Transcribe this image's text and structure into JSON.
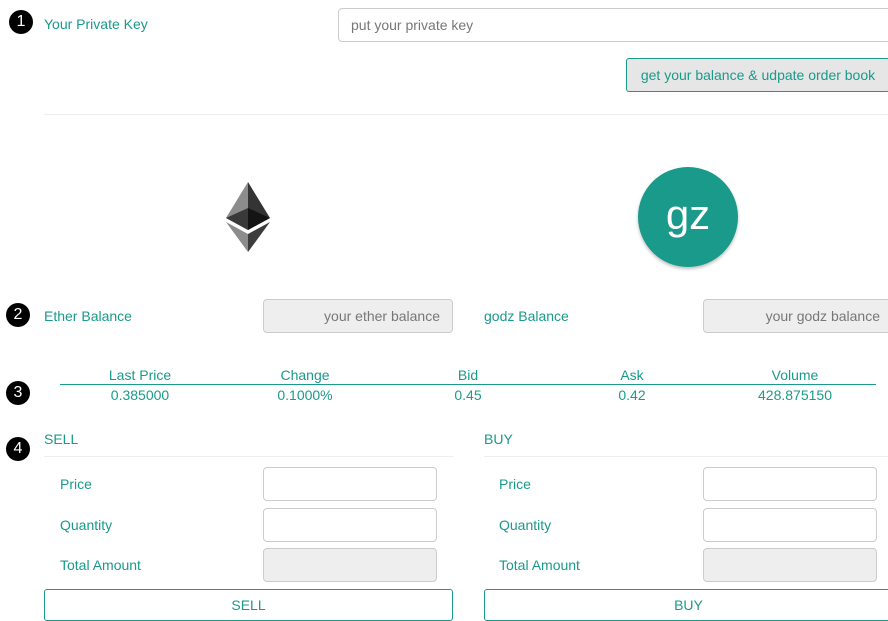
{
  "steps": [
    "1",
    "2",
    "3",
    "4"
  ],
  "private_key": {
    "label": "Your Private Key",
    "placeholder": "put your private key",
    "button": "get your balance & udpate order book"
  },
  "tokens": {
    "ether_icon": "ethereum-diamond-icon",
    "godz_logo_text": "gz",
    "godz_logo_color": "#1a9a8a"
  },
  "balances": {
    "ether_label": "Ether Balance",
    "ether_placeholder": "your ether balance",
    "godz_label": "godz Balance",
    "godz_placeholder": "your godz balance"
  },
  "stats": {
    "headers": [
      "Last Price",
      "Change",
      "Bid",
      "Ask",
      "Volume"
    ],
    "values": [
      "0.385000",
      "0.1000%",
      "0.45",
      "0.42",
      "428.875150"
    ]
  },
  "sell": {
    "title": "SELL",
    "price_label": "Price",
    "quantity_label": "Quantity",
    "total_label": "Total Amount",
    "button": "SELL"
  },
  "buy": {
    "title": "BUY",
    "price_label": "Price",
    "quantity_label": "Quantity",
    "total_label": "Total Amount",
    "button": "BUY"
  },
  "colors": {
    "accent": "#1a9a8a",
    "disabled": "#eeeeee"
  }
}
